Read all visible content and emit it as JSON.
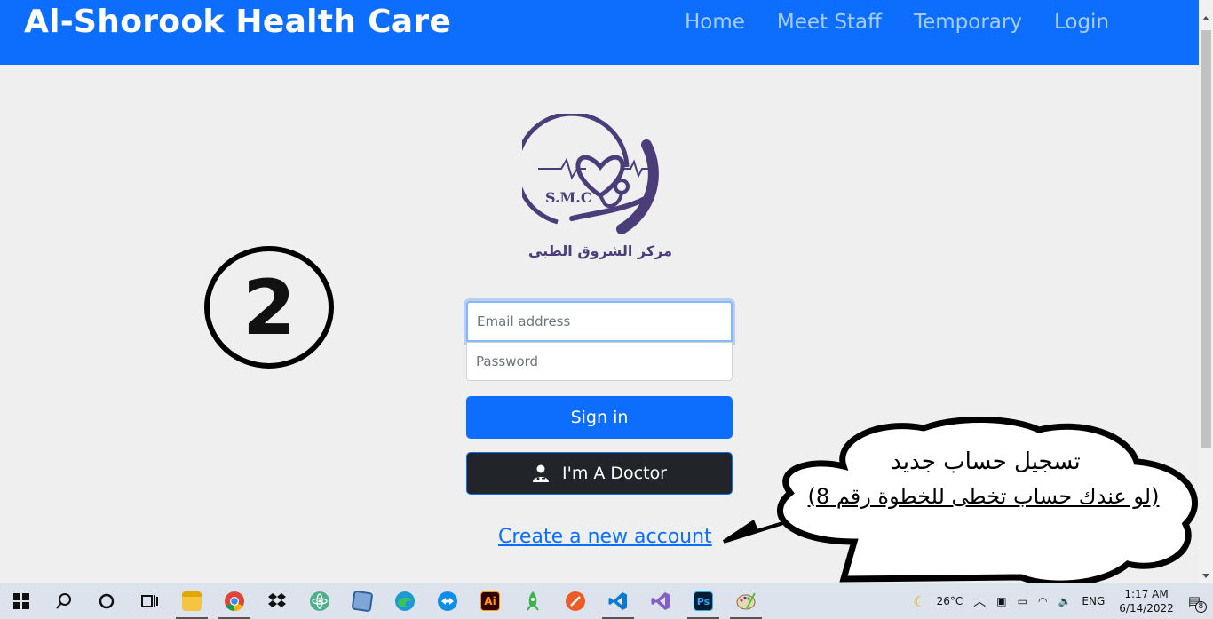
{
  "navbar": {
    "brand": "Al-Shorook Health Care",
    "links": [
      "Home",
      "Meet Staff",
      "Temporary",
      "Login"
    ]
  },
  "logo": {
    "initials": "S.M.C",
    "arabic_name": "مركز الشروق الطبى"
  },
  "form": {
    "email_placeholder": "Email address",
    "password_placeholder": "Password",
    "signin_label": "Sign in",
    "doctor_label": "I'm A Doctor",
    "create_account_label": "Create a new account"
  },
  "annotation": {
    "step_number": "2",
    "bubble_line1": "تسجيل حساب جديد",
    "bubble_line2": "(لو عندك حساب تخطى للخطوة رقم 8)"
  },
  "taskbar": {
    "temperature": "26°C",
    "language": "ENG",
    "time": "1:17 AM",
    "date": "6/14/2022",
    "notification_count": "8"
  },
  "colors": {
    "primary": "#0d6efd",
    "dark_button": "#212529",
    "page_bg": "#efefef",
    "logo_purple": "#4b3d7a"
  }
}
